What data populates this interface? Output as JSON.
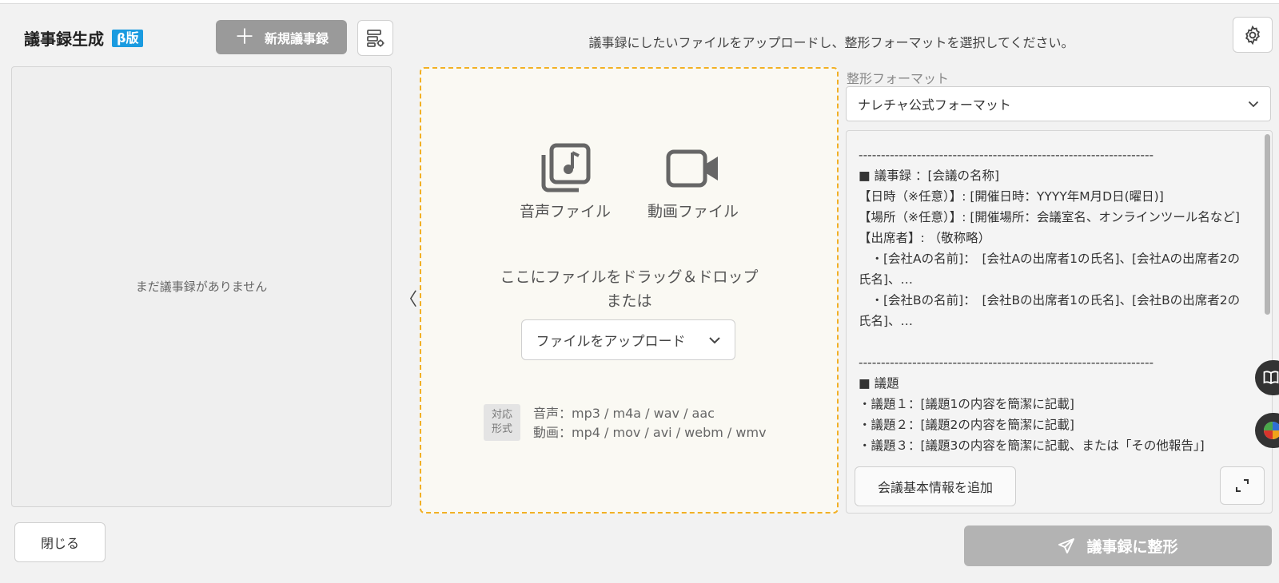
{
  "header": {
    "title": "議事録生成",
    "beta_badge": "β版",
    "new_button_label": "新規議事録",
    "instruction": "議事録にしたいファイルをアップロードし、整形フォーマットを選択してください。"
  },
  "sidebar": {
    "empty_message": "まだ議事録がありません",
    "collapse_glyph": "〈"
  },
  "upload": {
    "audio_label": "音声ファイル",
    "video_label": "動画ファイル",
    "drop_line1": "ここにファイルをドラッグ＆ドロップ",
    "drop_line2": "または",
    "upload_button_label": "ファイルをアップロード",
    "formats_label_line1": "対応",
    "formats_label_line2": "形式",
    "audio_formats": "音声：mp3 / m4a / wav / aac",
    "video_formats": "動画：mp4 / mov / avi / webm / wmv"
  },
  "format": {
    "label": "整形フォーマット",
    "selected": "ナレチャ公式フォーマット",
    "preview_lines": [
      "------------------------------------------------------------------",
      "■ 議事録 ：[会議の名称]",
      "【日時（※任意）】: [開催日時：YYYY年M月D日(曜日)]",
      "【場所（※任意）】: [開催場所：会議室名、オンラインツール名など]",
      "【出席者】: （敬称略）",
      "　・[会社Aの名前]：　[会社Aの出席者1の氏名]、[会社Aの出席者2の氏名]、…",
      "　・[会社Bの名前]：　[会社Bの出席者1の氏名]、[会社Bの出席者2の氏名]、…",
      "",
      "------------------------------------------------------------------",
      "■ 議題",
      "・議題１：[議題1の内容を簡潔に記載]",
      "・議題２：[議題2の内容を簡潔に記載]",
      "・議題３：[議題3の内容を簡潔に記載、または「その他報告」]"
    ],
    "add_info_button_label": "会議基本情報を追加"
  },
  "footer": {
    "close_button_label": "閉じる",
    "format_button_label": "議事録に整形"
  },
  "colors": {
    "beta": "#1a9be0",
    "dropzone_border": "#f2b024",
    "disabled_button": "#b3b3b3"
  }
}
